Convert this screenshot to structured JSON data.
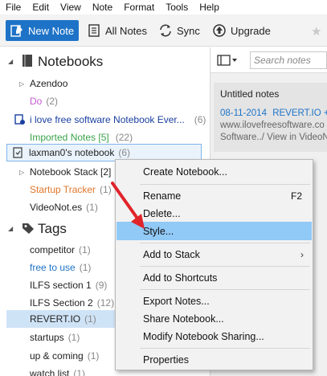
{
  "menubar": [
    "File",
    "Edit",
    "View",
    "Note",
    "Format",
    "Tools",
    "Help"
  ],
  "toolbar": {
    "new_note": "New Note",
    "all_notes": "All Notes",
    "sync": "Sync",
    "upgrade": "Upgrade"
  },
  "sidebar": {
    "notebooks_header": "Notebooks",
    "notebooks": [
      {
        "label": "Azendoo",
        "count": "",
        "color": "#222222"
      },
      {
        "label": "Do",
        "count": "(2)",
        "color": "#c55bd0"
      },
      {
        "label": "i love free software Notebook Ever...",
        "count": "(6)",
        "color": "#1a3fa0"
      },
      {
        "label": "Imported Notes [5]",
        "count": "(22)",
        "color": "#3aa34a"
      },
      {
        "label": "laxman0's notebook",
        "count": "(6)",
        "color": "#222222"
      },
      {
        "label": "Notebook Stack [2]",
        "count": "",
        "color": "#222222"
      },
      {
        "label": "Startup Tracker",
        "count": "(1)",
        "color": "#e0762b"
      },
      {
        "label": "VideoNot.es",
        "count": "(1)",
        "color": "#222222"
      }
    ],
    "tags_header": "Tags",
    "tags": [
      {
        "label": "competitor",
        "count": "(1)",
        "color": "#222222"
      },
      {
        "label": "free to use",
        "count": "(1)",
        "color": "#1e73c7"
      },
      {
        "label": "ILFS section 1",
        "count": "(9)",
        "color": "#222222"
      },
      {
        "label": "ILFS Section 2",
        "count": "(12)",
        "color": "#222222"
      },
      {
        "label": "REVERT.IO",
        "count": "(1)",
        "color": "#222222"
      },
      {
        "label": "startups",
        "count": "(1)",
        "color": "#222222"
      },
      {
        "label": "up & coming",
        "count": "(1)",
        "color": "#222222"
      },
      {
        "label": "watch list",
        "count": "(1)",
        "color": "#222222"
      }
    ]
  },
  "right_pane": {
    "search_placeholder": "Search notes",
    "note_title": "Untitled notes",
    "note_date": "08-11-2014",
    "note_line1_rest": "REVERT.IO +",
    "note_line2": "www.ilovefreesoftware.co",
    "note_line3": "Software../ View in VideoN"
  },
  "context_menu": {
    "items": [
      {
        "label": "Create Notebook...",
        "shortcut": "",
        "submenu": false
      },
      {
        "label": "Rename",
        "shortcut": "F2",
        "submenu": false
      },
      {
        "label": "Delete...",
        "shortcut": "",
        "submenu": false
      },
      {
        "label": "Style...",
        "shortcut": "",
        "submenu": false,
        "highlighted": true
      },
      {
        "label": "Add to Stack",
        "shortcut": "",
        "submenu": true
      },
      {
        "label": "Add to Shortcuts",
        "shortcut": "",
        "submenu": false
      },
      {
        "label": "Export Notes...",
        "shortcut": "",
        "submenu": false
      },
      {
        "label": "Share Notebook...",
        "shortcut": "",
        "submenu": false
      },
      {
        "label": "Modify Notebook Sharing...",
        "shortcut": "",
        "submenu": false
      },
      {
        "label": "Properties",
        "shortcut": "",
        "submenu": false
      }
    ]
  },
  "colors": {
    "accent": "#1e73c7",
    "menu_highlight": "#91c9f7",
    "annotation_arrow": "#e0242a"
  }
}
